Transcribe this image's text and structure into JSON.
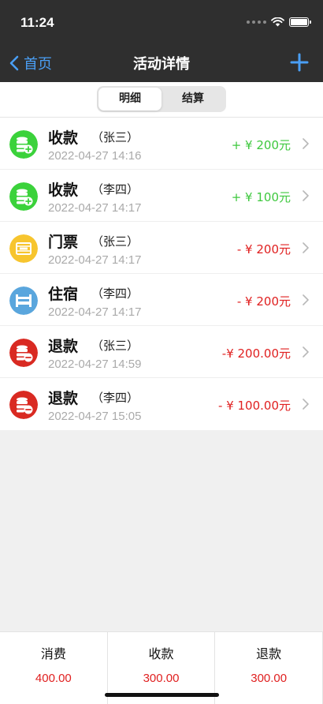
{
  "status_bar": {
    "time": "11:24"
  },
  "nav": {
    "back_label": "首页",
    "title": "活动详情"
  },
  "segment": {
    "tabs": [
      {
        "label": "明细",
        "active": true
      },
      {
        "label": "结算",
        "active": false
      }
    ]
  },
  "records": [
    {
      "title": "收款",
      "name": "（张三）",
      "date": "2022-04-27 14:16",
      "amount": "+ ¥ 200元",
      "type": "income",
      "icon": "money-in-icon",
      "icon_color": "#3bd23b"
    },
    {
      "title": "收款",
      "name": "（李四）",
      "date": "2022-04-27 14:17",
      "amount": "+ ¥ 100元",
      "type": "income",
      "icon": "money-in-icon",
      "icon_color": "#3bd23b"
    },
    {
      "title": "门票",
      "name": "（张三）",
      "date": "2022-04-27 14:17",
      "amount": "- ¥ 200元",
      "type": "expense",
      "icon": "ticket-icon",
      "icon_color": "#f7c52e"
    },
    {
      "title": "住宿",
      "name": "（李四）",
      "date": "2022-04-27 14:17",
      "amount": "- ¥ 200元",
      "type": "expense",
      "icon": "bed-icon",
      "icon_color": "#5aa6dd"
    },
    {
      "title": "退款",
      "name": "（张三）",
      "date": "2022-04-27 14:59",
      "amount": "-¥ 200.00元",
      "type": "expense",
      "icon": "refund-icon",
      "icon_color": "#d92a22"
    },
    {
      "title": "退款",
      "name": "（李四）",
      "date": "2022-04-27 15:05",
      "amount": "- ¥ 100.00元",
      "type": "expense",
      "icon": "refund-icon",
      "icon_color": "#d92a22"
    }
  ],
  "footer": [
    {
      "label": "消费",
      "value": "400.00"
    },
    {
      "label": "收款",
      "value": "300.00"
    },
    {
      "label": "退款",
      "value": "300.00"
    }
  ],
  "colors": {
    "accent": "#4a9ff5",
    "income": "#3ec83e",
    "expense": "#e02020"
  }
}
